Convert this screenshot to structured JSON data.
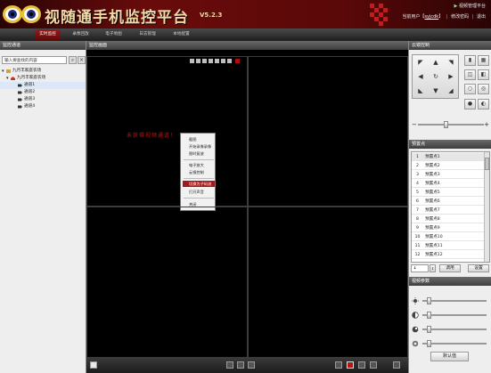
{
  "header": {
    "title": "视随通手机监控平台",
    "version": "V5.2.3",
    "admin_link": "视频管理平台",
    "user_prefix": "当前用户【",
    "username": "syjcdk",
    "user_suffix": "】",
    "change_password": "修改密码",
    "logout": "退出"
  },
  "nav": {
    "tabs": [
      "实时监控",
      "录像回放",
      "电子地图",
      "日志管理",
      "本地配置"
    ],
    "active": "实时监控"
  },
  "left_panel": {
    "title": "监控通道",
    "search_placeholder": "输入要查找的内容",
    "tree": {
      "root": "九月丰家庭农场",
      "group": "九月丰家庭农场",
      "channels": [
        "通道1",
        "通道2",
        "通道3",
        "通道4"
      ]
    }
  },
  "monitor": {
    "title": "监控画面",
    "no_video_text": "未获得视频通道！",
    "context_menu": {
      "items": [
        "截图",
        "开始录像录像",
        "图时复放",
        "电子放大",
        "云镜控制",
        "切换为子码流",
        "打开声音",
        "关闭"
      ],
      "highlighted": "切换为子码流"
    }
  },
  "right_panel": {
    "ptz_title": "云镜控制",
    "presets_title": "预置点",
    "presets": [
      {
        "num": "1",
        "name": "预置点1"
      },
      {
        "num": "2",
        "name": "预置点2"
      },
      {
        "num": "3",
        "name": "预置点3"
      },
      {
        "num": "4",
        "name": "预置点4"
      },
      {
        "num": "5",
        "name": "预置点5"
      },
      {
        "num": "6",
        "name": "预置点6"
      },
      {
        "num": "7",
        "name": "预置点7"
      },
      {
        "num": "8",
        "name": "预置点8"
      },
      {
        "num": "9",
        "name": "预置点9"
      },
      {
        "num": "10",
        "name": "预置点10"
      },
      {
        "num": "11",
        "name": "预置点11"
      },
      {
        "num": "12",
        "name": "预置点12"
      }
    ],
    "preset_value": "1",
    "call_button": "调用",
    "set_button": "设置",
    "video_params_title": "视频参数",
    "default_button": "默认值",
    "ptz_speed_fraction": 0.42
  },
  "colors": {
    "brand_red": "#a81010",
    "header_bg": "#6a0b0b",
    "title_gold": "#f2d9a8",
    "no_video_red": "#c01818"
  }
}
